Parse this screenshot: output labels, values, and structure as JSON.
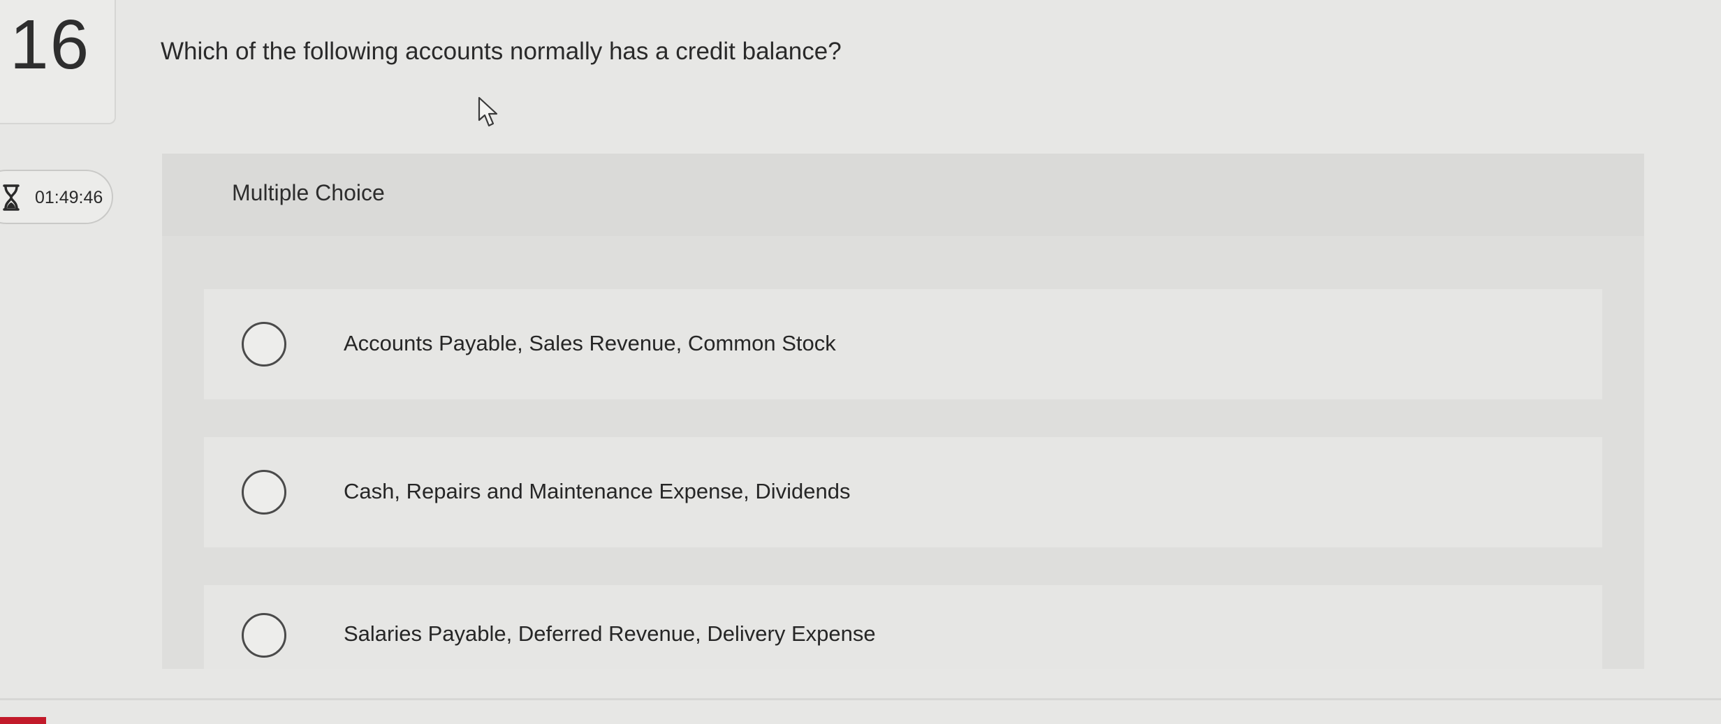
{
  "question": {
    "number": "16",
    "text": "Which of the following accounts normally has a credit balance?"
  },
  "timer": {
    "icon": "hourglass-icon",
    "value": "01:49:46"
  },
  "multiple_choice": {
    "label": "Multiple Choice",
    "options": [
      {
        "text": "Accounts Payable, Sales Revenue, Common Stock",
        "selected": false
      },
      {
        "text": "Cash, Repairs and Maintenance Expense, Dividends",
        "selected": false
      },
      {
        "text": "Salaries Payable, Deferred Revenue, Delivery Expense",
        "selected": false
      }
    ]
  },
  "colors": {
    "background": "#e7e7e5",
    "panel": "#dededc",
    "option_background": "#e6e6e4",
    "radio_border": "#4a4a4a",
    "accent_red": "#c21a2a"
  }
}
